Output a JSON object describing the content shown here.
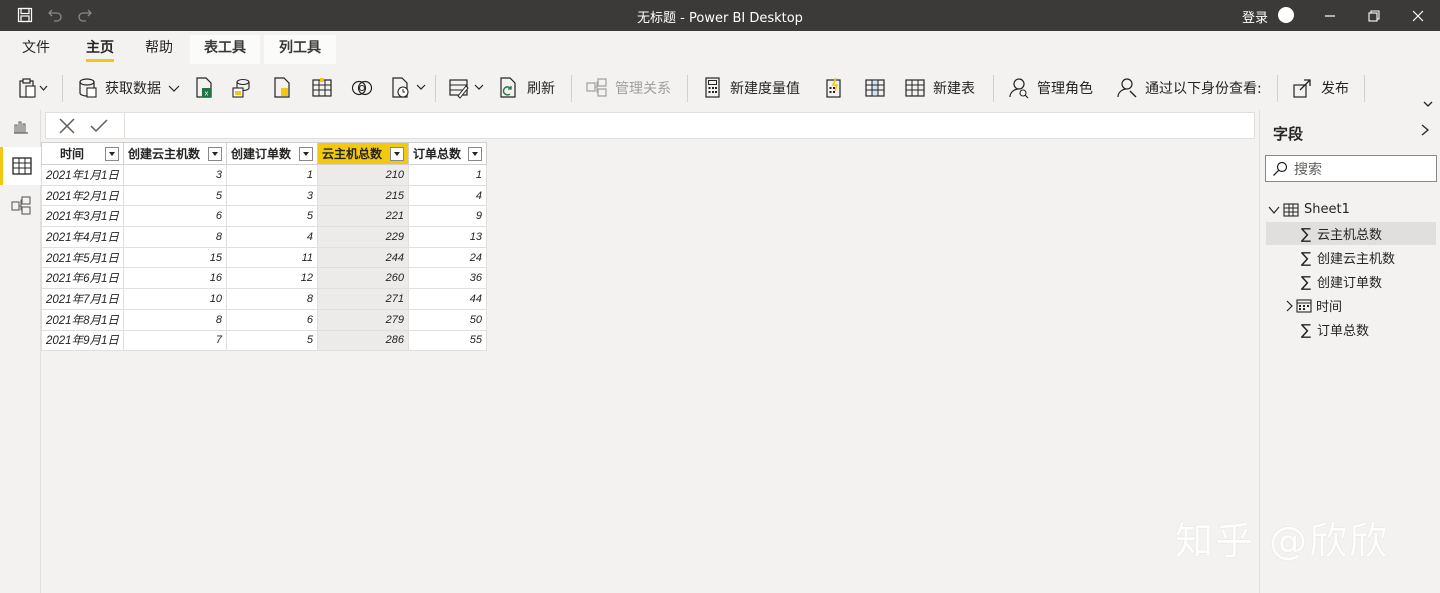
{
  "titlebar": {
    "title": "无标题 - Power BI Desktop",
    "login": "登录"
  },
  "tabs": [
    {
      "label": "文件"
    },
    {
      "label": "主页"
    },
    {
      "label": "帮助"
    },
    {
      "label": "表工具"
    },
    {
      "label": "列工具"
    }
  ],
  "ribbon": {
    "get_data": "获取数据",
    "refresh": "刷新",
    "manage_relationships": "管理关系",
    "new_measure": "新建度量值",
    "new_table": "新建表",
    "manage_roles": "管理角色",
    "view_as": "通过以下身份查看:",
    "publish": "发布"
  },
  "grid": {
    "columns": [
      "时间",
      "创建云主机数",
      "创建订单数",
      "云主机总数",
      "订单总数"
    ],
    "rows": [
      [
        "2021年1月1日",
        "3",
        "1",
        "210",
        "1"
      ],
      [
        "2021年2月1日",
        "5",
        "3",
        "215",
        "4"
      ],
      [
        "2021年3月1日",
        "6",
        "5",
        "221",
        "9"
      ],
      [
        "2021年4月1日",
        "8",
        "4",
        "229",
        "13"
      ],
      [
        "2021年5月1日",
        "15",
        "11",
        "244",
        "24"
      ],
      [
        "2021年6月1日",
        "16",
        "12",
        "260",
        "36"
      ],
      [
        "2021年7月1日",
        "10",
        "8",
        "271",
        "44"
      ],
      [
        "2021年8月1日",
        "8",
        "6",
        "279",
        "50"
      ],
      [
        "2021年9月1日",
        "7",
        "5",
        "286",
        "55"
      ]
    ],
    "highlight_color": "#f2c811"
  },
  "fields_pane": {
    "title": "字段",
    "search_placeholder": "搜索",
    "table_name": "Sheet1",
    "fields": [
      {
        "label": "云主机总数"
      },
      {
        "label": "创建云主机数"
      },
      {
        "label": "创建订单数"
      },
      {
        "label": "时间"
      },
      {
        "label": "订单总数"
      }
    ]
  },
  "watermark": "知乎 @欣欣",
  "colors": {
    "titlebar": "#3b3a39",
    "accent": "#f2c811",
    "background": "#f3f2f1"
  }
}
